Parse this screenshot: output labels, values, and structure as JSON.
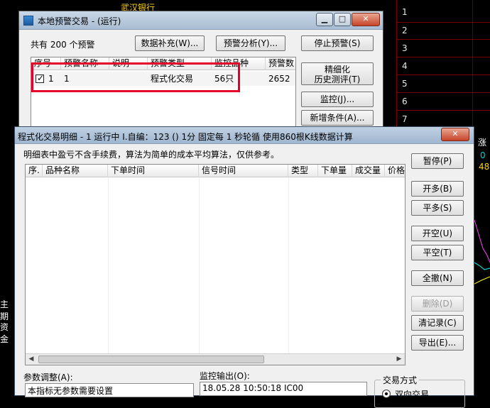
{
  "background": {
    "stock_name": "武汉银行",
    "right_numbers": [
      "1",
      "2",
      "3",
      "4",
      "5",
      "6",
      "7"
    ],
    "left_fragments": [
      "主期",
      "资金"
    ],
    "right_fragments": [
      "涨",
      "0",
      "48"
    ]
  },
  "alert_window": {
    "title": "本地预警交易 - (运行)",
    "count_label": "共有 200 个预警",
    "buttons": {
      "data_supplement": "数据补充(W)...",
      "alert_analysis": "预警分析(Y)...",
      "stop_alert": "停止预警(S)",
      "refine_line1": "精细化",
      "refine_line2": "历史测评(T)",
      "monitor": "监控(J)...",
      "add_condition": "新增条件(A)..."
    },
    "columns": [
      "序号",
      "预警名称",
      "说明",
      "预警类型",
      "监控品种",
      "预警数"
    ],
    "rows": [
      {
        "checked": true,
        "seq": "1",
        "name": "1",
        "desc": "",
        "type": "程式化交易",
        "symbols": "56只",
        "count": "2652"
      }
    ]
  },
  "detail_window": {
    "title": "程式化交易明细 - 1 运行中 I.自编：123 () 1分 固定每 1 秒轮循 使用860根K线数据计算",
    "note": "明细表中盈亏不含手续费，算法为简单的成本平均算法，仅供参考。",
    "columns": [
      "序.",
      "品种名称",
      "下单时间",
      "信号时间",
      "类型",
      "下单量",
      "成交量",
      "价格"
    ],
    "buttons": {
      "pause": "暂停(P)",
      "open_long": "开多(B)",
      "close_long": "平多(S)",
      "open_short": "开空(U)",
      "close_short": "平空(T)",
      "close_all": "全撤(N)",
      "delete": "删除(D)",
      "clear_log": "清记录(C)",
      "export": "导出(E)..."
    },
    "param_label": "参数调整(A):",
    "param_value": "本指标无参数需要设置",
    "monitor_label": "监控输出(O):",
    "monitor_value": "18.05.28 10:50:18 IC00",
    "trade_mode_label": "交易方式",
    "trade_mode_option": "双向交易"
  }
}
